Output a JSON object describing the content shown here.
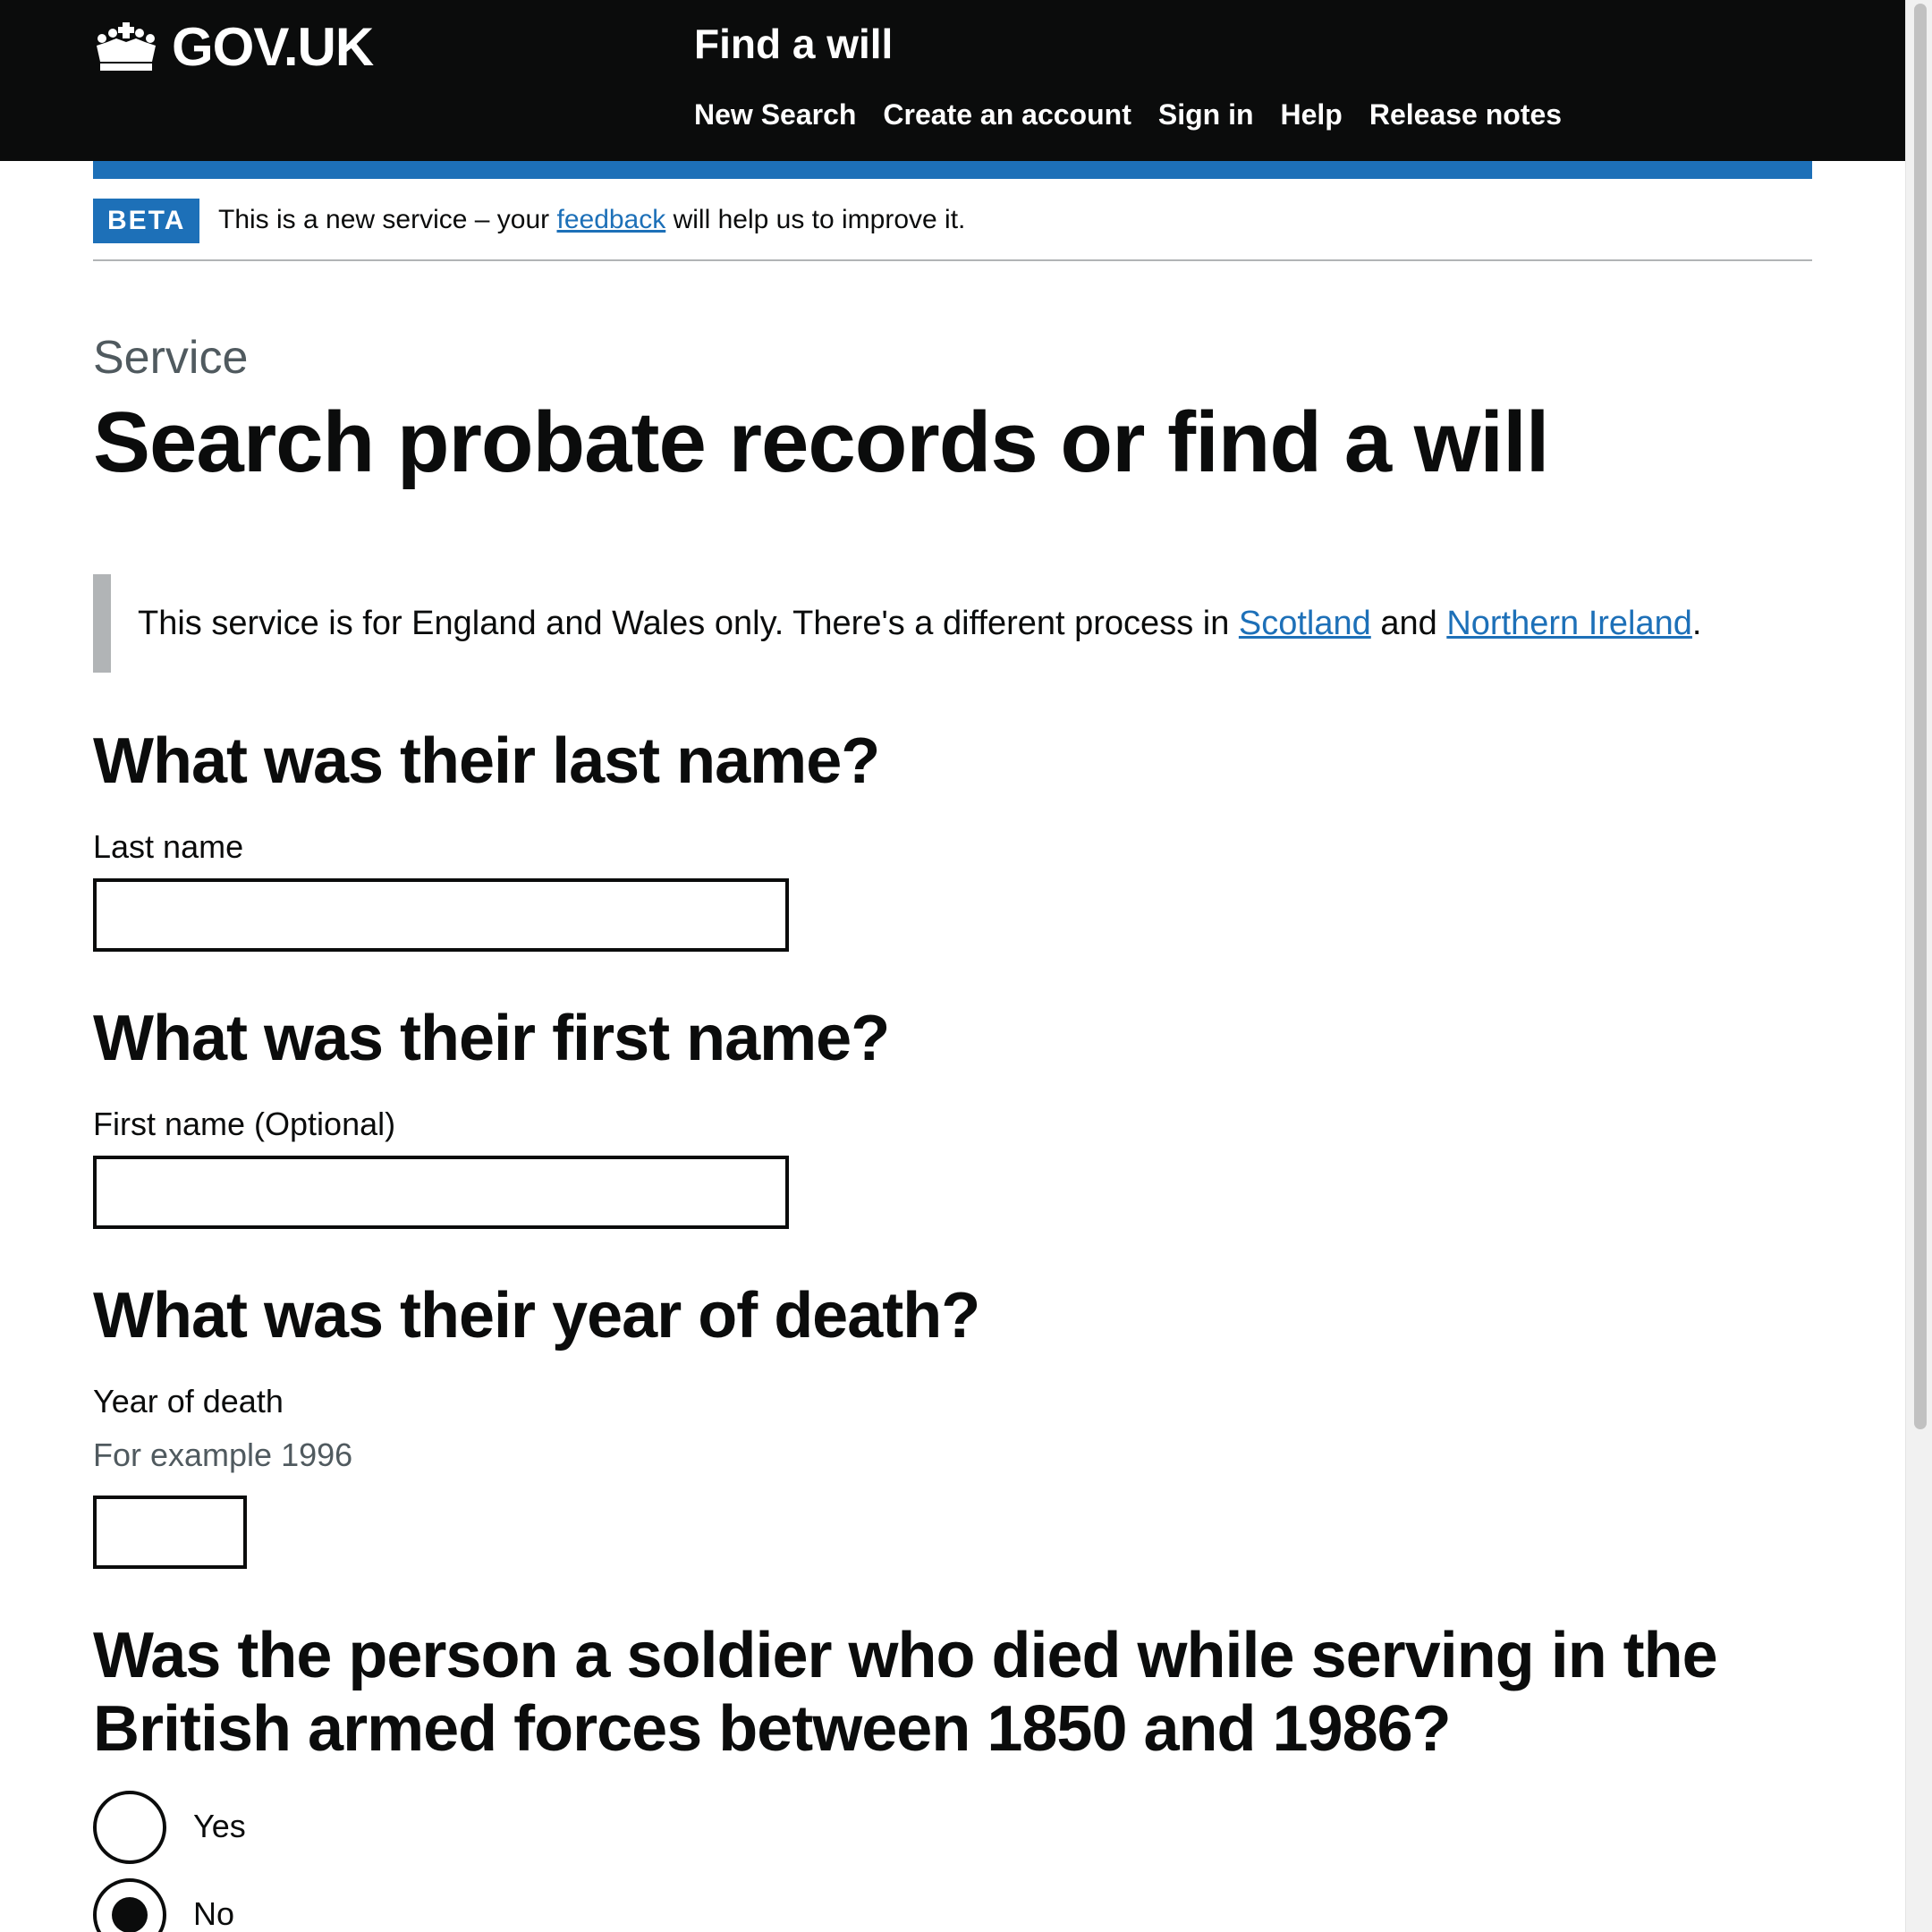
{
  "header": {
    "logo_text": "GOV.UK",
    "service_name": "Find a will",
    "nav": [
      "New Search",
      "Create an account",
      "Sign in",
      "Help",
      "Release notes"
    ]
  },
  "phase_banner": {
    "tag": "BETA",
    "text_before": "This is a new service – your ",
    "link": "feedback",
    "text_after": " will help us to improve it."
  },
  "caption": "Service",
  "title": "Search probate records or find a will",
  "inset": {
    "text_before": "This service is for England and Wales only. There's a different process in ",
    "link1": "Scotland",
    "text_mid": " and ",
    "link2": "Northern Ireland",
    "text_after": "."
  },
  "questions": {
    "last_name": {
      "heading": "What was their last name?",
      "label": "Last name",
      "value": ""
    },
    "first_name": {
      "heading": "What was their first name?",
      "label": "First name (Optional)",
      "value": ""
    },
    "year": {
      "heading": "What was their year of death?",
      "label": "Year of death",
      "hint": "For example 1996",
      "value": ""
    },
    "soldier": {
      "heading": "Was the person a soldier who died while serving in the British armed forces between 1850 and 1986?",
      "options": [
        {
          "label": "Yes",
          "checked": false
        },
        {
          "label": "No",
          "checked": true
        }
      ]
    }
  },
  "colors": {
    "header_bg": "#0b0c0c",
    "brand_blue": "#1d70b8",
    "text": "#0b0c0c",
    "secondary_text": "#505a5f",
    "border_grey": "#b1b4b6"
  },
  "icons": {
    "logo": "crown-icon"
  }
}
